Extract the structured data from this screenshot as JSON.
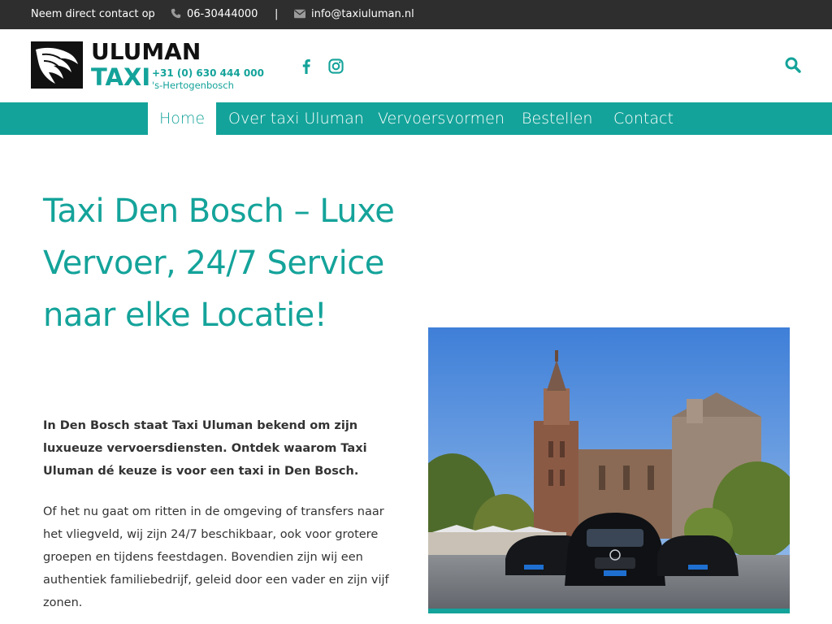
{
  "topbar": {
    "contact_label": "Neem direct contact op",
    "phone": "06-30444000",
    "separator": "|",
    "email": "info@taxiuluman.nl"
  },
  "logo": {
    "name": "ULUMAN",
    "taxi": "TAXI",
    "phone": "+31 (0) 630 444 000",
    "city": "'s-Hertogenbosch"
  },
  "nav": {
    "items": [
      {
        "label": "Home",
        "active": true
      },
      {
        "label": "Over taxi Uluman"
      },
      {
        "label": "Vervoersvormen"
      },
      {
        "label": "Bestellen"
      },
      {
        "label": "Contact"
      }
    ]
  },
  "main": {
    "title": "Taxi Den Bosch – Luxe Vervoer, 24/7 Service naar elke Locatie!",
    "intro": "In Den Bosch staat Taxi Uluman bekend om zijn luxueuze vervoersdiensten. Ontdek waarom Taxi Uluman dé keuze is voor een taxi in Den Bosch.",
    "body": "Of het nu gaat om ritten in de omgeving of transfers naar het vliegveld, wij zijn 24/7 beschikbaar, ook voor grotere groepen en tijdens feestdagen. Bovendien zijn wij een authentiek familiebedrijf, geleid door een vader en zijn vijf zonen."
  },
  "colors": {
    "accent": "#14a39a",
    "topbar_bg": "#2e2e2e"
  }
}
